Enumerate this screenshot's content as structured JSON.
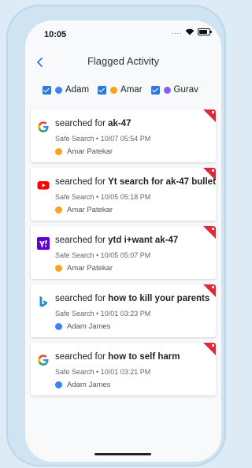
{
  "status": {
    "time": "10:05",
    "signal": "...."
  },
  "header": {
    "back_icon": "chevron-left-icon",
    "title": "Flagged Activity"
  },
  "filters": [
    {
      "label": "Adam",
      "checked": true,
      "avatar_color": "#3b82f6"
    },
    {
      "label": "Amar",
      "checked": true,
      "avatar_color": "#f5a524"
    },
    {
      "label": "Gurav",
      "checked": true,
      "avatar_color": "#8b5cf6"
    }
  ],
  "colors": {
    "accent": "#2f7ad9",
    "flag": "#e0283a"
  },
  "activities": [
    {
      "icon": "google-icon",
      "prefix": "searched for",
      "query": "ak-47",
      "meta": "Safe Search • 10/07 05:54 PM",
      "user": "Amar Patekar",
      "user_color": "#f5a524"
    },
    {
      "icon": "youtube-icon",
      "prefix": "searched for",
      "query": "Yt search for ak-47 bullets",
      "meta": "Safe Search • 10/05 05:18 PM",
      "user": "Amar Patekar",
      "user_color": "#f5a524"
    },
    {
      "icon": "yahoo-icon",
      "prefix": "searched for",
      "query": "ytd i+want ak-47",
      "meta": "Safe Search • 10/05 05:07 PM",
      "user": "Amar Patekar",
      "user_color": "#f5a524"
    },
    {
      "icon": "bing-icon",
      "prefix": "searched for",
      "query": "how to kill your parents",
      "meta": "Safe Search • 10/01 03:23 PM",
      "user": "Adam James",
      "user_color": "#3b82f6"
    },
    {
      "icon": "google-icon",
      "prefix": "searched for",
      "query": "how to self harm",
      "meta": "Safe Search • 10/01 03:21 PM",
      "user": "Adam James",
      "user_color": "#3b82f6"
    }
  ]
}
